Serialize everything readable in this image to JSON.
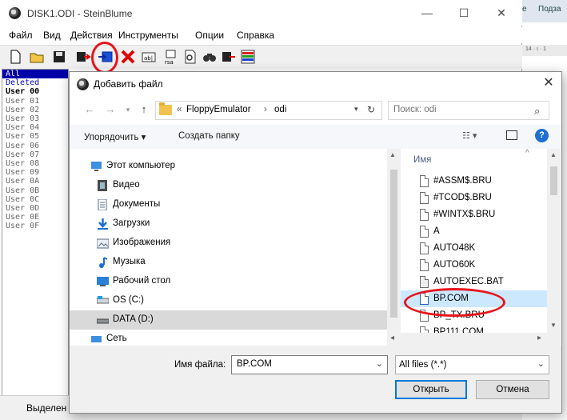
{
  "main": {
    "title": "DISK1.ODI - SteinBlume",
    "menu": [
      "Файл",
      "Вид",
      "Действия",
      "Инструменты",
      "Опции",
      "Справка"
    ],
    "user_list": [
      "All",
      "Deleted",
      "User 00",
      "User 01",
      "User 02",
      "User 03",
      "User 04",
      "User 05",
      "User 06",
      "User 07",
      "User 08",
      "User 09",
      "User 0A",
      "User 0B",
      "User 0C",
      "User 0D",
      "User 0E",
      "User 0F"
    ],
    "status": "Выделен"
  },
  "right_strip": {
    "tab_e": "е",
    "tab_label": "Подза",
    "ruler": "14 · ı · 1"
  },
  "dialog": {
    "title": "Добавить файл",
    "path": [
      "«",
      "FloppyEmulator",
      "›",
      "odi"
    ],
    "search_placeholder": "Поиск: odi",
    "organize": "Упорядочить ▾",
    "new_folder": "Создать папку",
    "nav_items": [
      {
        "label": "Этот компьютер",
        "icon": "computer-icon"
      },
      {
        "label": "Видео",
        "icon": "video-icon"
      },
      {
        "label": "Документы",
        "icon": "documents-icon"
      },
      {
        "label": "Загрузки",
        "icon": "downloads-icon"
      },
      {
        "label": "Изображения",
        "icon": "pictures-icon"
      },
      {
        "label": "Музыка",
        "icon": "music-icon"
      },
      {
        "label": "Рабочий стол",
        "icon": "desktop-icon"
      },
      {
        "label": "OS (C:)",
        "icon": "drive-icon"
      },
      {
        "label": "DATA (D:)",
        "icon": "drive-icon"
      },
      {
        "label": "Сеть",
        "icon": "network-icon"
      }
    ],
    "column_name": "Имя",
    "files": [
      "#ASSM$.BRU",
      "#TCOD$.BRU",
      "#WINTX$.BRU",
      "A",
      "AUTO48K",
      "AUTO60K",
      "AUTOEXEC.BAT",
      "BP.COM",
      "BP_TX.BRU",
      "BP111.COM"
    ],
    "selected_file": "BP.COM",
    "filename_label": "Имя файла:",
    "filename_value": "BP.COM",
    "filter": "All files (*.*)",
    "open": "Открыть",
    "cancel": "Отмена"
  }
}
